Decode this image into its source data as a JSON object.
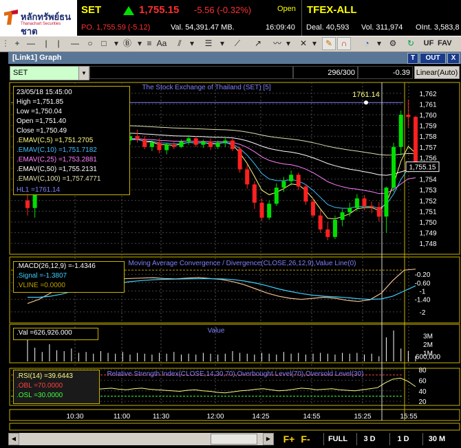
{
  "broker": {
    "name": "หลักทรัพย์ธนชาต",
    "sub": "Thanachart Securities"
  },
  "set": {
    "symbol": "SET",
    "last": "1,755.15",
    "change": "-5.56 (-0.32%)",
    "status": "Open",
    "po": "PO. 1,755.59 (-5.12)",
    "value": "Val. 54,391.47 MB.",
    "time": "16:09:40"
  },
  "tfex": {
    "symbol": "TFEX-ALL",
    "deal": "Deal. 40,593",
    "volume": "Vol. 311,974",
    "oint": "OInt. 3,583,8"
  },
  "toolbar": {
    "icons": [
      "crosshair-icon",
      "hline-icon",
      "vline-icon",
      "line-icon",
      "rect-icon",
      "circle-icon",
      "fib-icon",
      "text-icon",
      "trend-icon",
      "channel-icon",
      "pitchfork-icon",
      "zigzag-icon",
      "delete-icon",
      "pencil-icon",
      "magnet-icon",
      "cycle-icon",
      "settings-icon",
      "refresh-icon"
    ],
    "uf_label": "UF",
    "fav_label": "FAV"
  },
  "window": {
    "title": "[Link1] Graph",
    "btn_t": "T",
    "btn_out": "OUT",
    "btn_x": "X"
  },
  "symbol_row": {
    "selected": "SET",
    "counter": "296/300",
    "delta": "-0.39",
    "scale": "Linear(Auto)"
  },
  "chart_data": [
    {
      "type": "candlestick",
      "title": "The Stock Exchange of Thailand (SET) [5]",
      "ylim": [
        1747.5,
        1762.5
      ],
      "y_ticks": [
        "1,762",
        "1,761",
        "1,760",
        "1,759",
        "1,758",
        "1,757",
        "1,756",
        "1,755",
        "1,754",
        "1,753",
        "1,752",
        "1,751",
        "1,750",
        "1,749",
        "1,748"
      ],
      "last_price_label": "1,755.15",
      "hl1_label": "1761.14",
      "info": {
        "date": "23/05/18 15:45:00",
        "high": "High =1,751.85",
        "low": "Low =1,750.04",
        "open": "Open =1,751.40",
        "close": "Close =1,750.49",
        "emav5": ".EMAV(C,5) =1,751.2705",
        "emav10": ".EMAV(C,10) =1,751.7182",
        "emav25": ".EMAV(C,25) =1,753.2881",
        "emav50": ".EMAV(C,50) =1,755.2131",
        "emav100": ".EMAV(C,100) =1,757.4771",
        "hl1": "HL1 =1761.14"
      },
      "colors": {
        "up": "#00e000",
        "down": "#ff2020",
        "emav5": "#ffff80",
        "emav10": "#40c0ff",
        "emav25": "#ff80ff",
        "emav50": "#ffffff",
        "emav100": "#e0e0b0"
      },
      "candles": [
        [
          1752.0,
          1752.6,
          1750.6,
          1751.3
        ],
        [
          1751.3,
          1753.0,
          1750.4,
          1752.7
        ],
        [
          1757.1,
          1759.2,
          1756.7,
          1758.6
        ],
        [
          1758.6,
          1759.0,
          1757.2,
          1757.5
        ],
        [
          1757.5,
          1758.3,
          1757.0,
          1757.9
        ],
        [
          1757.9,
          1758.4,
          1757.2,
          1757.4
        ],
        [
          1757.4,
          1758.2,
          1756.9,
          1757.9
        ],
        [
          1757.9,
          1759.0,
          1757.5,
          1758.6
        ],
        [
          1758.6,
          1759.2,
          1757.8,
          1758.0
        ],
        [
          1758.0,
          1758.4,
          1757.2,
          1757.6
        ],
        [
          1757.6,
          1758.8,
          1757.3,
          1758.4
        ],
        [
          1758.4,
          1758.9,
          1757.5,
          1757.8
        ],
        [
          1757.8,
          1758.0,
          1756.8,
          1757.1
        ],
        [
          1757.1,
          1757.9,
          1756.9,
          1757.6
        ],
        [
          1757.6,
          1758.3,
          1757.2,
          1758.0
        ],
        [
          1758.0,
          1758.6,
          1757.4,
          1757.7
        ],
        [
          1757.7,
          1758.0,
          1756.8,
          1757.0
        ],
        [
          1757.0,
          1757.6,
          1756.6,
          1757.4
        ],
        [
          1757.4,
          1757.8,
          1756.4,
          1756.7
        ],
        [
          1756.7,
          1757.4,
          1756.3,
          1757.2
        ],
        [
          1757.2,
          1757.6,
          1756.8,
          1757.0
        ],
        [
          1757.0,
          1757.7,
          1756.9,
          1757.5
        ],
        [
          1757.5,
          1758.1,
          1757.2,
          1757.8
        ],
        [
          1757.8,
          1758.0,
          1757.0,
          1757.2
        ],
        [
          1757.2,
          1757.7,
          1756.9,
          1757.5
        ],
        [
          1757.5,
          1757.8,
          1756.7,
          1757.0
        ],
        [
          1757.0,
          1757.6,
          1756.8,
          1757.4
        ],
        [
          1757.4,
          1757.9,
          1757.0,
          1757.6
        ],
        [
          1757.6,
          1757.8,
          1756.6,
          1756.8
        ],
        [
          1756.8,
          1757.0,
          1754.6,
          1754.9
        ],
        [
          1754.9,
          1755.4,
          1753.1,
          1753.5
        ],
        [
          1753.5,
          1753.8,
          1751.2,
          1751.8
        ],
        [
          1751.8,
          1752.2,
          1750.1,
          1750.4
        ],
        [
          1750.4,
          1752.0,
          1750.2,
          1751.7
        ],
        [
          1751.7,
          1753.6,
          1751.5,
          1753.2
        ],
        [
          1753.2,
          1754.2,
          1752.8,
          1753.8
        ],
        [
          1753.8,
          1754.8,
          1753.4,
          1754.4
        ],
        [
          1754.4,
          1754.6,
          1753.0,
          1753.3
        ],
        [
          1753.3,
          1753.5,
          1751.6,
          1751.9
        ],
        [
          1751.9,
          1752.2,
          1750.4,
          1750.6
        ],
        [
          1750.6,
          1751.1,
          1749.0,
          1749.3
        ],
        [
          1749.3,
          1750.0,
          1748.3,
          1748.6
        ],
        [
          1748.6,
          1750.6,
          1748.4,
          1750.2
        ],
        [
          1750.2,
          1751.2,
          1749.6,
          1750.9
        ],
        [
          1750.9,
          1751.8,
          1750.5,
          1751.3
        ],
        [
          1751.3,
          1752.6,
          1751.0,
          1752.2
        ],
        [
          1752.2,
          1752.5,
          1751.1,
          1751.5
        ],
        [
          1751.5,
          1751.9,
          1750.8,
          1751.4
        ],
        [
          1751.4,
          1751.85,
          1750.04,
          1750.49
        ],
        [
          1750.5,
          1753.3,
          1749.0,
          1753.2
        ],
        [
          1753.2,
          1757.4,
          1752.8,
          1757.0
        ],
        [
          1757.0,
          1760.4,
          1756.2,
          1760.0
        ],
        [
          1760.0,
          1761.4,
          1758.8,
          1759.8
        ],
        [
          1759.8,
          1759.9,
          1754.8,
          1755.15
        ]
      ],
      "x_ticks": [
        "10:30",
        "11:00",
        "11:30",
        "12:00",
        "14:25",
        "14:55",
        "15:25",
        "15:55"
      ]
    },
    {
      "type": "line",
      "title": "Moving Average Convergence / Divergence(CLOSE,26,12,9),Value Line(0)",
      "ylim": [
        -2.4,
        0.5
      ],
      "y_ticks": [
        "-0.20",
        "-0.60",
        "-1",
        "-1.40",
        "-2"
      ],
      "info": {
        "macd": ".MACD(26,12,9) =-1.4346",
        "signal": ".Signal =-1.3807",
        "vline": ".VLINE =0.0000"
      },
      "series": [
        {
          "name": ".MACD(26,12,9)",
          "color": "#f0c090",
          "values": [
            -1.6,
            -1.4,
            -1.1,
            -0.8,
            -0.65,
            -0.55,
            -0.5,
            -0.45,
            -0.42,
            -0.4,
            -0.38,
            -0.36,
            -0.4,
            -0.42,
            -0.38,
            -0.35,
            -0.4,
            -0.45,
            -0.55,
            -0.7,
            -0.9,
            -1.1,
            -1.25,
            -1.35,
            -1.4,
            -1.35,
            -1.3,
            -1.35,
            -1.45,
            -1.5,
            -1.42,
            -1.1,
            -0.5,
            0.0,
            0.05
          ]
        },
        {
          "name": ".Signal",
          "color": "#40d0ff",
          "values": [
            -1.3,
            -1.3,
            -1.25,
            -1.15,
            -1.0,
            -0.9,
            -0.8,
            -0.7,
            -0.62,
            -0.55,
            -0.5,
            -0.46,
            -0.44,
            -0.43,
            -0.42,
            -0.41,
            -0.41,
            -0.42,
            -0.45,
            -0.52,
            -0.62,
            -0.75,
            -0.9,
            -1.02,
            -1.12,
            -1.2,
            -1.25,
            -1.28,
            -1.32,
            -1.37,
            -1.4,
            -1.38,
            -1.25,
            -1.0,
            -0.75
          ]
        }
      ]
    },
    {
      "type": "bar",
      "title": "Value",
      "y_ticks": [
        "3M",
        "2M",
        "1M",
        "600,000"
      ],
      "info": {
        "val": ".Val =626,926.000"
      },
      "values": [
        3.1,
        1.6,
        1.1,
        2.0,
        1.3,
        1.2,
        1.5,
        1.0,
        1.1,
        0.9,
        1.2,
        1.0,
        0.9,
        1.1,
        0.8,
        1.0,
        0.9,
        0.8,
        1.0,
        0.9,
        1.1,
        0.8,
        0.9,
        0.8,
        1.0,
        0.9,
        0.8,
        0.9,
        1.2,
        1.0,
        0.9,
        0.8,
        1.0,
        0.9,
        0.8,
        1.1,
        0.9,
        1.0,
        0.8,
        0.9,
        1.0,
        0.9,
        0.8,
        1.0,
        0.9,
        1.0,
        0.8,
        0.9,
        0.6,
        2.8,
        3.6,
        1.5,
        1.2,
        0.6
      ]
    },
    {
      "type": "line",
      "title": "Relative Strength Index(CLOSE,14,30,70),Overbought Level(70),Oversold Level(30)",
      "ylim": [
        15,
        80
      ],
      "y_ticks": [
        "80",
        "60",
        "40",
        "20"
      ],
      "info": {
        "rsi": ".RSI(14) =39.6443",
        "obl": ".OBL =70.0000",
        "osl": ".OSL =30.0000"
      },
      "series": [
        {
          "name": ".RSI(14)",
          "color": "#ffff80",
          "values": [
            42,
            44,
            46,
            45,
            43,
            44,
            45,
            46,
            44,
            43,
            44,
            45,
            43,
            42,
            44,
            45,
            43,
            42,
            41,
            40,
            39,
            41,
            42,
            40,
            39,
            37,
            36,
            38,
            40,
            41,
            43,
            44,
            42,
            40,
            41,
            43,
            45,
            44,
            42,
            43,
            44,
            42,
            41,
            40,
            42,
            44,
            46,
            55,
            62,
            64,
            58,
            48
          ]
        },
        {
          "name": ".OBL",
          "color": "#ff4040",
          "values": [
            70
          ]
        },
        {
          "name": ".OSL",
          "color": "#40ff40",
          "values": [
            30
          ]
        }
      ]
    }
  ],
  "tabs": {
    "fplus": "F+",
    "fminus": "F-",
    "full": "FULL",
    "d3": "3 D",
    "d1": "1 D",
    "m30": "30 M"
  }
}
